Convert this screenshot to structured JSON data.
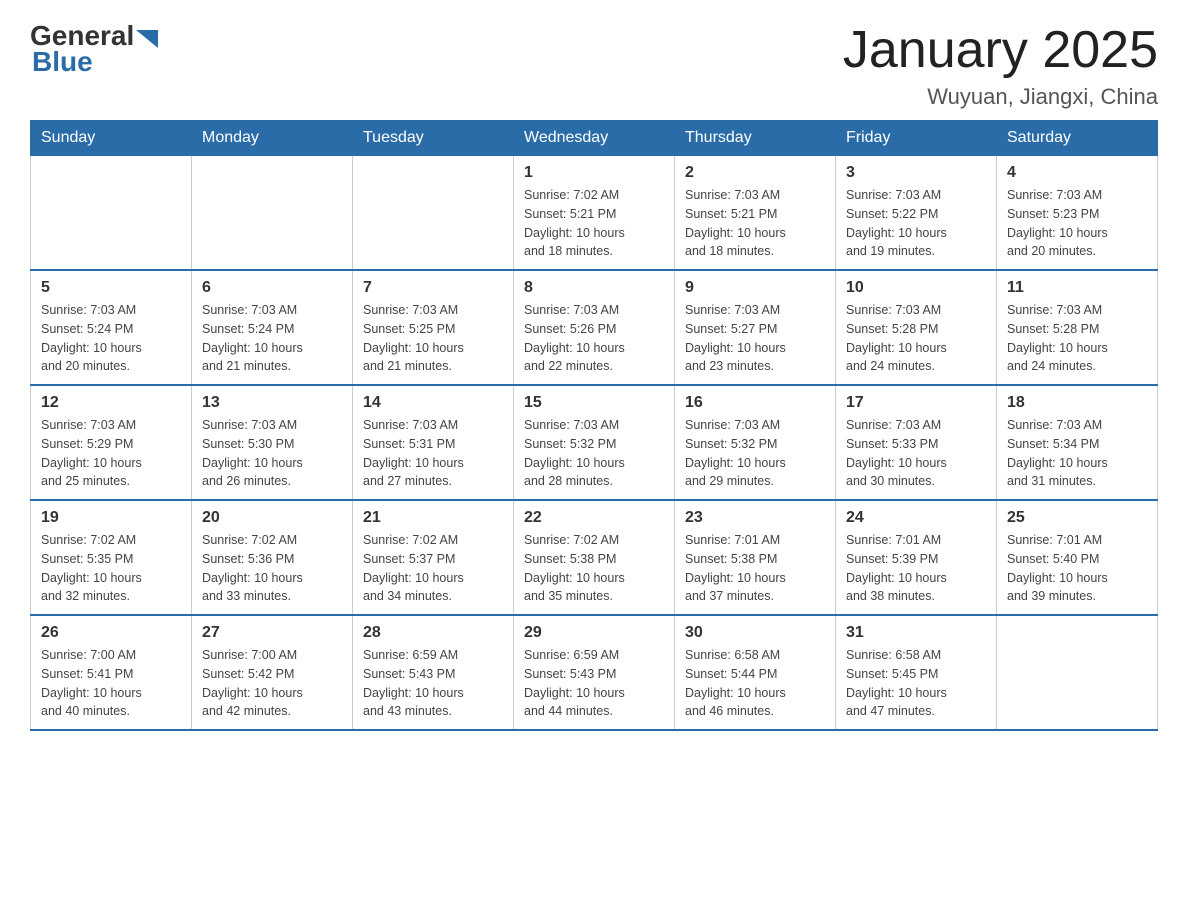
{
  "header": {
    "logo_general": "General",
    "logo_blue": "Blue",
    "title": "January 2025",
    "subtitle": "Wuyuan, Jiangxi, China"
  },
  "weekdays": [
    "Sunday",
    "Monday",
    "Tuesday",
    "Wednesday",
    "Thursday",
    "Friday",
    "Saturday"
  ],
  "weeks": [
    [
      {
        "day": "",
        "info": ""
      },
      {
        "day": "",
        "info": ""
      },
      {
        "day": "",
        "info": ""
      },
      {
        "day": "1",
        "info": "Sunrise: 7:02 AM\nSunset: 5:21 PM\nDaylight: 10 hours\nand 18 minutes."
      },
      {
        "day": "2",
        "info": "Sunrise: 7:03 AM\nSunset: 5:21 PM\nDaylight: 10 hours\nand 18 minutes."
      },
      {
        "day": "3",
        "info": "Sunrise: 7:03 AM\nSunset: 5:22 PM\nDaylight: 10 hours\nand 19 minutes."
      },
      {
        "day": "4",
        "info": "Sunrise: 7:03 AM\nSunset: 5:23 PM\nDaylight: 10 hours\nand 20 minutes."
      }
    ],
    [
      {
        "day": "5",
        "info": "Sunrise: 7:03 AM\nSunset: 5:24 PM\nDaylight: 10 hours\nand 20 minutes."
      },
      {
        "day": "6",
        "info": "Sunrise: 7:03 AM\nSunset: 5:24 PM\nDaylight: 10 hours\nand 21 minutes."
      },
      {
        "day": "7",
        "info": "Sunrise: 7:03 AM\nSunset: 5:25 PM\nDaylight: 10 hours\nand 21 minutes."
      },
      {
        "day": "8",
        "info": "Sunrise: 7:03 AM\nSunset: 5:26 PM\nDaylight: 10 hours\nand 22 minutes."
      },
      {
        "day": "9",
        "info": "Sunrise: 7:03 AM\nSunset: 5:27 PM\nDaylight: 10 hours\nand 23 minutes."
      },
      {
        "day": "10",
        "info": "Sunrise: 7:03 AM\nSunset: 5:28 PM\nDaylight: 10 hours\nand 24 minutes."
      },
      {
        "day": "11",
        "info": "Sunrise: 7:03 AM\nSunset: 5:28 PM\nDaylight: 10 hours\nand 24 minutes."
      }
    ],
    [
      {
        "day": "12",
        "info": "Sunrise: 7:03 AM\nSunset: 5:29 PM\nDaylight: 10 hours\nand 25 minutes."
      },
      {
        "day": "13",
        "info": "Sunrise: 7:03 AM\nSunset: 5:30 PM\nDaylight: 10 hours\nand 26 minutes."
      },
      {
        "day": "14",
        "info": "Sunrise: 7:03 AM\nSunset: 5:31 PM\nDaylight: 10 hours\nand 27 minutes."
      },
      {
        "day": "15",
        "info": "Sunrise: 7:03 AM\nSunset: 5:32 PM\nDaylight: 10 hours\nand 28 minutes."
      },
      {
        "day": "16",
        "info": "Sunrise: 7:03 AM\nSunset: 5:32 PM\nDaylight: 10 hours\nand 29 minutes."
      },
      {
        "day": "17",
        "info": "Sunrise: 7:03 AM\nSunset: 5:33 PM\nDaylight: 10 hours\nand 30 minutes."
      },
      {
        "day": "18",
        "info": "Sunrise: 7:03 AM\nSunset: 5:34 PM\nDaylight: 10 hours\nand 31 minutes."
      }
    ],
    [
      {
        "day": "19",
        "info": "Sunrise: 7:02 AM\nSunset: 5:35 PM\nDaylight: 10 hours\nand 32 minutes."
      },
      {
        "day": "20",
        "info": "Sunrise: 7:02 AM\nSunset: 5:36 PM\nDaylight: 10 hours\nand 33 minutes."
      },
      {
        "day": "21",
        "info": "Sunrise: 7:02 AM\nSunset: 5:37 PM\nDaylight: 10 hours\nand 34 minutes."
      },
      {
        "day": "22",
        "info": "Sunrise: 7:02 AM\nSunset: 5:38 PM\nDaylight: 10 hours\nand 35 minutes."
      },
      {
        "day": "23",
        "info": "Sunrise: 7:01 AM\nSunset: 5:38 PM\nDaylight: 10 hours\nand 37 minutes."
      },
      {
        "day": "24",
        "info": "Sunrise: 7:01 AM\nSunset: 5:39 PM\nDaylight: 10 hours\nand 38 minutes."
      },
      {
        "day": "25",
        "info": "Sunrise: 7:01 AM\nSunset: 5:40 PM\nDaylight: 10 hours\nand 39 minutes."
      }
    ],
    [
      {
        "day": "26",
        "info": "Sunrise: 7:00 AM\nSunset: 5:41 PM\nDaylight: 10 hours\nand 40 minutes."
      },
      {
        "day": "27",
        "info": "Sunrise: 7:00 AM\nSunset: 5:42 PM\nDaylight: 10 hours\nand 42 minutes."
      },
      {
        "day": "28",
        "info": "Sunrise: 6:59 AM\nSunset: 5:43 PM\nDaylight: 10 hours\nand 43 minutes."
      },
      {
        "day": "29",
        "info": "Sunrise: 6:59 AM\nSunset: 5:43 PM\nDaylight: 10 hours\nand 44 minutes."
      },
      {
        "day": "30",
        "info": "Sunrise: 6:58 AM\nSunset: 5:44 PM\nDaylight: 10 hours\nand 46 minutes."
      },
      {
        "day": "31",
        "info": "Sunrise: 6:58 AM\nSunset: 5:45 PM\nDaylight: 10 hours\nand 47 minutes."
      },
      {
        "day": "",
        "info": ""
      }
    ]
  ]
}
